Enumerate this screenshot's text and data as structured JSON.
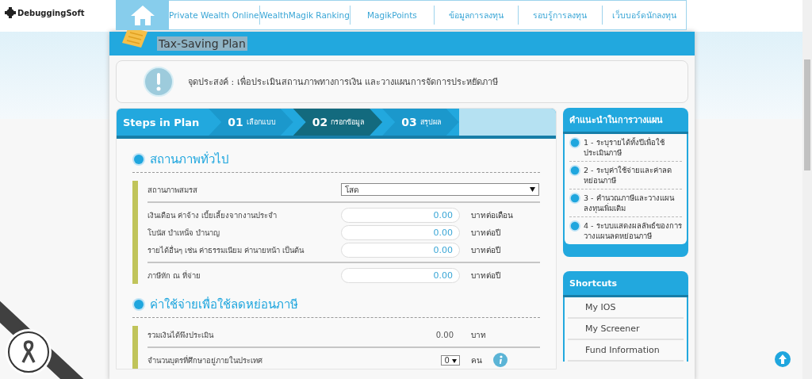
{
  "logo": {
    "text": "DebuggingSoft"
  },
  "nav": {
    "items": [
      {
        "label": "Private Wealth Online"
      },
      {
        "label": "WealthMagik Ranking"
      },
      {
        "label": "MagikPoints"
      },
      {
        "label": "ข้อมูลการลงทุน"
      },
      {
        "label": "รอบรู้การลงทุน"
      },
      {
        "label": "เว็บบอร์ดนักลงทุน"
      }
    ]
  },
  "page_title": {
    "text": "Tax-Saving Plan",
    "highlighted": true
  },
  "notice": {
    "text": "จุดประสงค์ : เพื่อประเมินสถานภาพทางการเงิน และวางแผนการจัดการประหยัดภาษี"
  },
  "steps": {
    "title": "Steps in Plan",
    "items": [
      {
        "number": "01",
        "label": "เลือกแบบ",
        "selected": false
      },
      {
        "number": "02",
        "label": "กรอกข้อมูล",
        "selected": true
      },
      {
        "number": "03",
        "label": "สรุปผล",
        "selected": false
      }
    ]
  },
  "sections": [
    {
      "title": "สถานภาพทั่วไป",
      "groups": [
        [
          {
            "kind": "select",
            "label": "สถานภาพสมรส",
            "value": "โสด"
          }
        ],
        [
          {
            "kind": "amount",
            "label": "เงินเดือน ค่าจ้าง เบี้ยเลี้ยงจากงานประจำ",
            "value": "0.00",
            "unit": "บาทต่อเดือน"
          },
          {
            "kind": "amount",
            "label": "โบนัส บำเหน็จ บำนาญ",
            "value": "0.00",
            "unit": "บาทต่อปี"
          },
          {
            "kind": "amount",
            "label": "รายได้อื่นๆ เช่น ค่าธรรมเนียม ค่านายหน้า เป็นต้น",
            "value": "0.00",
            "unit": "บาทต่อปี"
          }
        ],
        [
          {
            "kind": "amount",
            "label": "ภาษีหัก ณ ที่จ่าย",
            "value": "0.00",
            "unit": "บาทต่อปี"
          }
        ]
      ]
    },
    {
      "title": "ค่าใช้จ่ายเพื่อใช้ลดหย่อนภาษี",
      "groups": [
        [
          {
            "kind": "readout",
            "label": "รวมเงินได้พึงประเมิน",
            "value": "0.00",
            "unit": "บาท"
          }
        ],
        [
          {
            "kind": "count",
            "label": "จำนวนบุตรที่ศึกษาอยู่ภายในประเทศ",
            "value": "0",
            "unit": "คน",
            "info": true
          }
        ]
      ]
    }
  ],
  "tips": {
    "title": "คำแนะนำในการวางแผน",
    "items": [
      {
        "text": "1 - ระบุรายได้ทั้งปีเพื่อใช้ประเมินภาษี"
      },
      {
        "text": "2 - ระบุค่าใช้จ่ายและค่าลดหย่อนภาษี"
      },
      {
        "text": "3 - คำนวณภาษีและวางแผนลงทุนเพิ่มเติม"
      },
      {
        "text": "4 - ระบบแสดงผลลัพธ์ของการวางแผนลดหย่อนภาษี"
      }
    ]
  },
  "shortcuts": {
    "title": "Shortcuts",
    "items": [
      {
        "label": "My IOS"
      },
      {
        "label": "My Screener"
      },
      {
        "label": "Fund Information"
      }
    ]
  }
}
